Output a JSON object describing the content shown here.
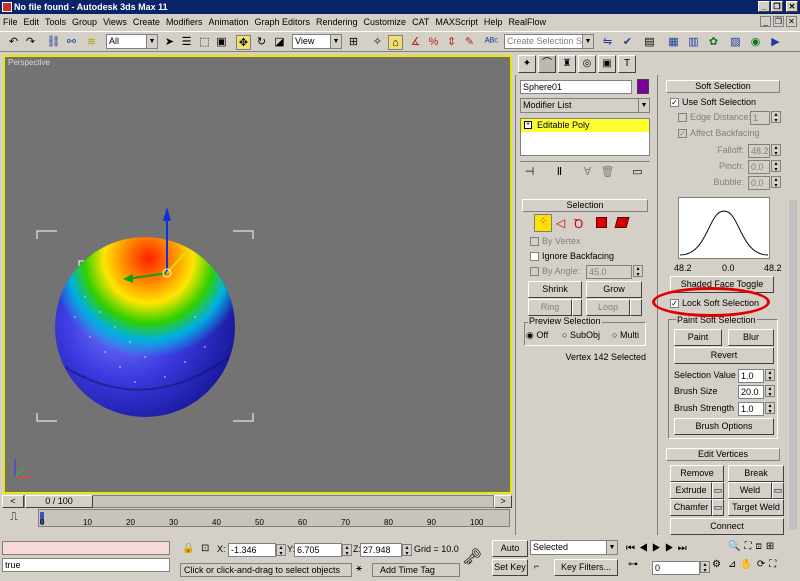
{
  "title": "No file found   - Autodesk 3ds Max 11",
  "window_buttons": [
    "_",
    "❐",
    "✕"
  ],
  "menu": [
    "File",
    "Edit",
    "Tools",
    "Group",
    "Views",
    "Create",
    "Modifiers",
    "Animation",
    "Graph Editors",
    "Rendering",
    "Customize",
    "CAT",
    "MAXScript",
    "Help",
    "RealFlow"
  ],
  "toolbar": {
    "filter": "All",
    "refcoord": "View",
    "selset": "Create Selection Set"
  },
  "viewport": {
    "label": "Perspective"
  },
  "command": {
    "object_name": "Sphere01",
    "object_color": "#7b0099",
    "modifier_list": "Modifier List",
    "stack_item": "Editable Poly"
  },
  "selection": {
    "header": "Selection",
    "by_vertex": "By Vertex",
    "ignore_backfacing": "Ignore Backfacing",
    "by_angle": "By Angle:",
    "angle_value": "45.0",
    "shrink": "Shrink",
    "grow": "Grow",
    "ring": "Ring",
    "loop": "Loop",
    "preview_header": "Preview Selection",
    "off": "Off",
    "subobj": "SubObj",
    "multi": "Multi",
    "status": "Vertex 142 Selected"
  },
  "soft": {
    "header": "Soft Selection",
    "use_soft": "Use Soft Selection",
    "edge_distance": "Edge Distance:",
    "edge_value": "1",
    "affect_backfacing": "Affect Backfacing",
    "falloff": "Falloff:",
    "falloff_value": "48.2",
    "pinch": "Pinch:",
    "pinch_value": "0.0",
    "bubble": "Bubble:",
    "bubble_value": "0.0",
    "curve_left": "48.2",
    "curve_mid": "0.0",
    "curve_right": "48.2",
    "shaded_face": "Shaded Face Toggle",
    "lock_soft": "Lock Soft Selection",
    "paint_header": "Paint Soft Selection",
    "paint": "Paint",
    "blur": "Blur",
    "revert": "Revert",
    "sel_value": "Selection Value",
    "sel_value_v": "1.0",
    "brush_size": "Brush Size",
    "brush_size_v": "20.0",
    "brush_strength": "Brush Strength",
    "brush_strength_v": "1.0",
    "brush_options": "Brush Options"
  },
  "edit_vertices": {
    "header": "Edit Vertices",
    "remove": "Remove",
    "break": "Break",
    "extrude": "Extrude",
    "weld": "Weld",
    "chamfer": "Chamfer",
    "target_weld": "Target Weld",
    "connect": "Connect"
  },
  "timeline": {
    "frame": "0 / 100",
    "ticks": [
      "0",
      "10",
      "20",
      "30",
      "40",
      "50",
      "60",
      "70",
      "80",
      "90",
      "100"
    ]
  },
  "status": {
    "listener": "true",
    "x_label": "X:",
    "x": "-1.346",
    "y_label": "Y:",
    "y": "6.705",
    "z_label": "Z:",
    "z": "27.948",
    "grid": "Grid = 10.0",
    "prompt": "Click or click-and-drag to select objects",
    "add_time_tag": "Add Time Tag",
    "auto_key": "Auto Key",
    "set_key": "Set Key",
    "selected": "Selected",
    "key_filters": "Key Filters...",
    "frame_field": "0"
  }
}
